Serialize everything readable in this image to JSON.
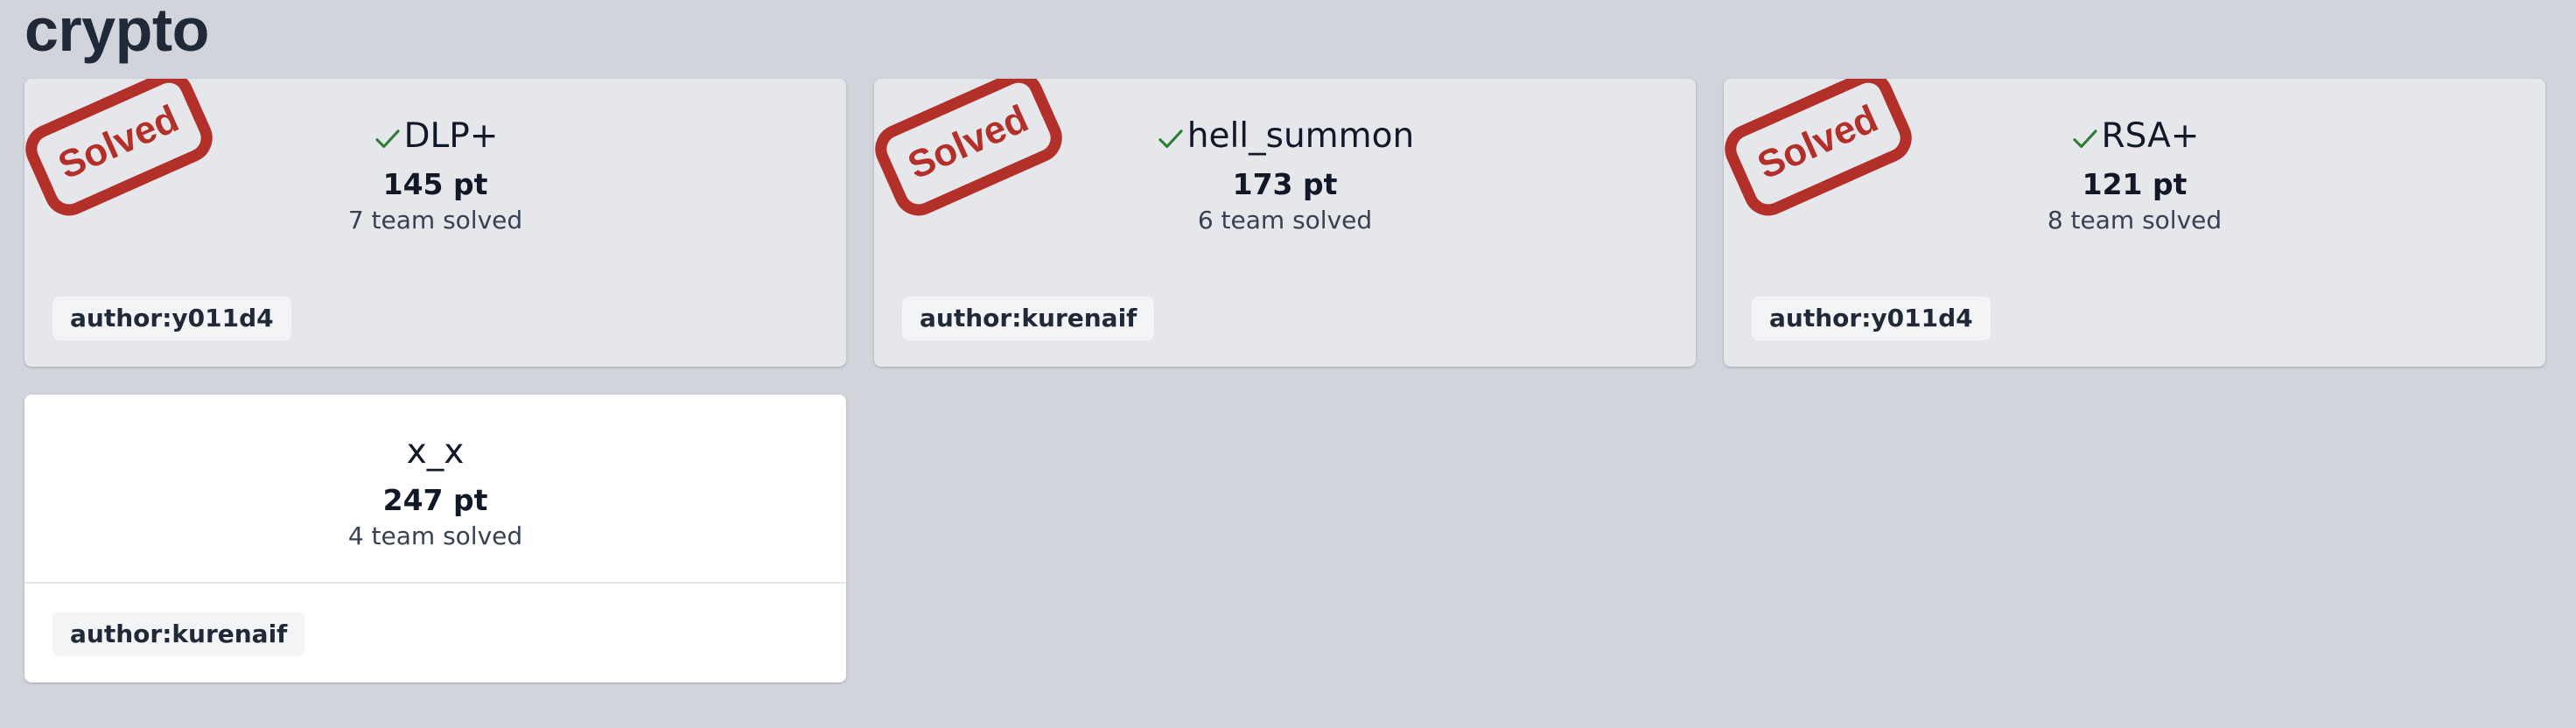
{
  "category": {
    "title": "crypto"
  },
  "stamp_label": "Solved",
  "colors": {
    "background": "#d1d5db",
    "solved_card": "#e5e7eb",
    "unsolved_card": "#ffffff",
    "stamp_red": "#b3302a",
    "check_green": "#2e7d32"
  },
  "challenges": [
    {
      "name": "DLP+",
      "points": "145 pt",
      "solves": "7 team solved",
      "author": "author:y011d4",
      "solved": true
    },
    {
      "name": "hell_summon",
      "points": "173 pt",
      "solves": "6 team solved",
      "author": "author:kurenaif",
      "solved": true
    },
    {
      "name": "RSA+",
      "points": "121 pt",
      "solves": "8 team solved",
      "author": "author:y011d4",
      "solved": true
    },
    {
      "name": "x_x",
      "points": "247 pt",
      "solves": "4 team solved",
      "author": "author:kurenaif",
      "solved": false
    }
  ]
}
